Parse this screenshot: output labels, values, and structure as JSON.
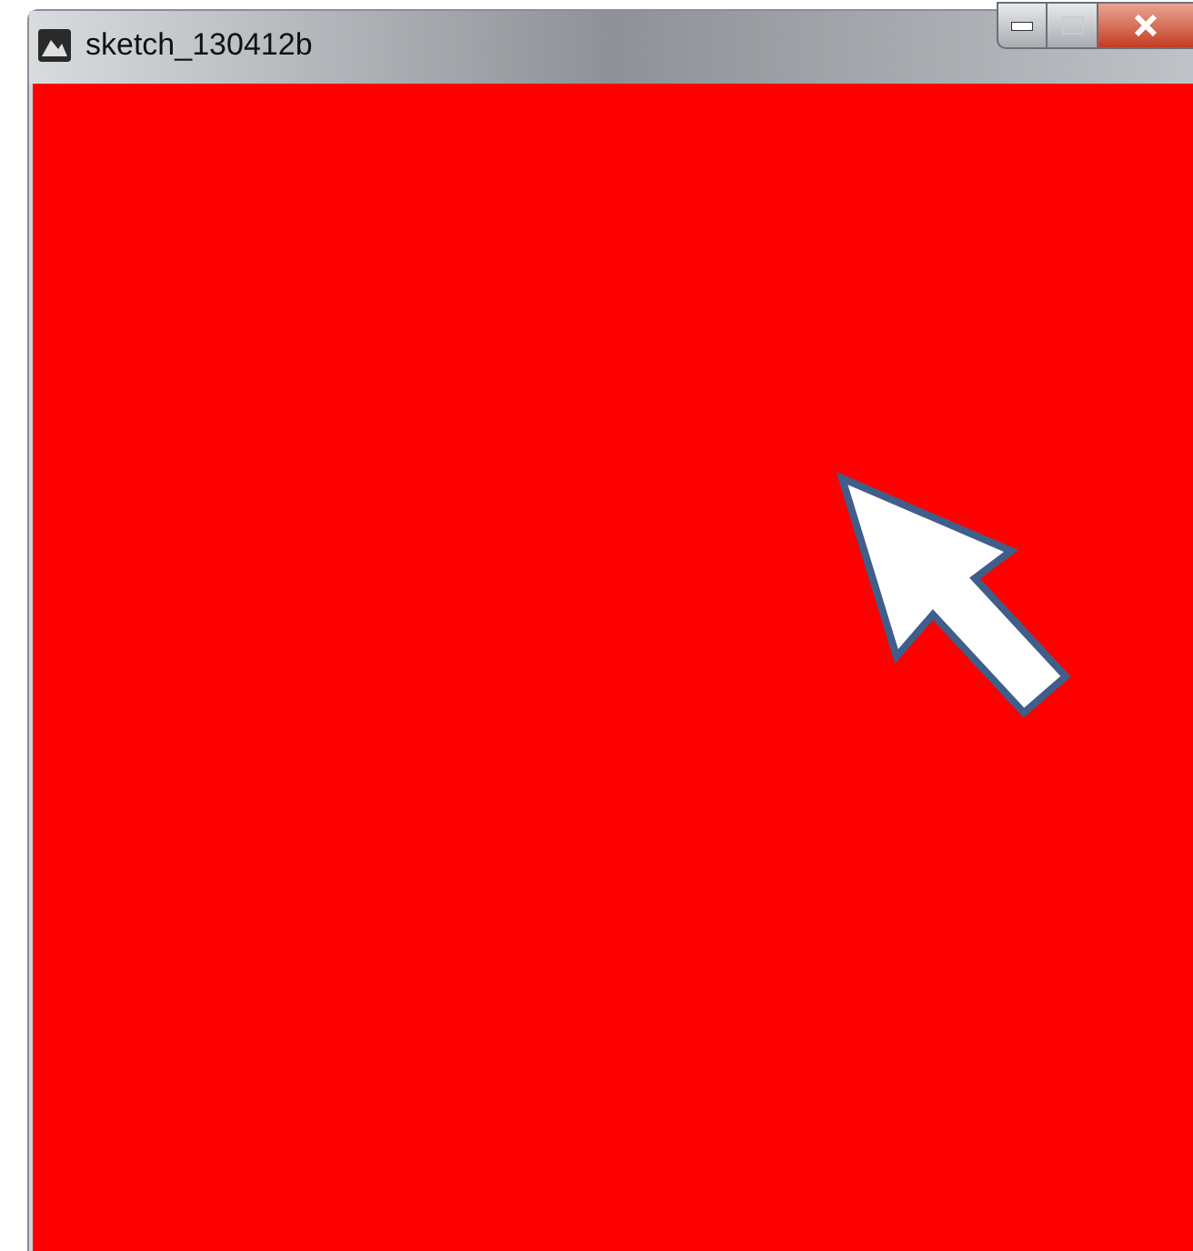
{
  "window": {
    "title": "sketch_130412b"
  }
}
